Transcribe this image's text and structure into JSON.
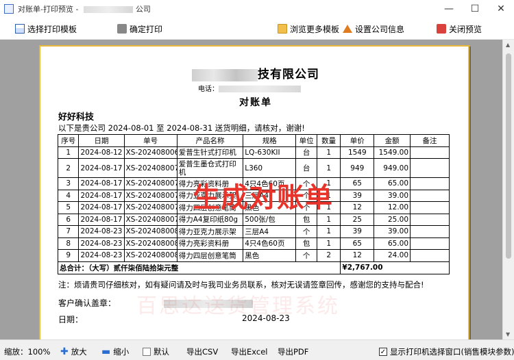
{
  "window": {
    "title_prefix": "对账单-打印预览 - ",
    "title_suffix": "公司",
    "buttons": {
      "minimize": "—",
      "maximize": "☐",
      "close": "✕"
    }
  },
  "toolbar": {
    "select_template": "选择打印模板",
    "confirm_print": "确定打印",
    "browse_templates": "浏览更多模板",
    "company_settings": "设置公司信息",
    "close_preview": "关闭预览"
  },
  "document": {
    "company_suffix": "技有限公司",
    "phone_label": "电话：",
    "title": "对账单",
    "customer": "好好科技",
    "intro": "以下是贵公司 2024-08-01 至 2024-08-31 送货明细，请核对，谢谢!",
    "headers": [
      "序号",
      "日期",
      "单号",
      "产品名称",
      "规格",
      "单位",
      "数量",
      "单价",
      "金额",
      "备注"
    ],
    "rows": [
      [
        "1",
        "2024-08-12",
        "XS-202408006",
        "爱普生针式打印机",
        "LQ-630KII",
        "台",
        "1",
        "1549",
        "1549.00",
        ""
      ],
      [
        "2",
        "2024-08-17",
        "XS-202408007",
        "爱普生墨仓式打印机",
        "L360",
        "台",
        "1",
        "949",
        "949.00",
        ""
      ],
      [
        "3",
        "2024-08-17",
        "XS-202408007",
        "得力亮彩资料册",
        "4只4色60页",
        "个",
        "1",
        "65",
        "65.00",
        ""
      ],
      [
        "4",
        "2024-08-17",
        "XS-202408007",
        "得力亚克力展示架",
        "三层A4",
        "个",
        "1",
        "39",
        "39.00",
        ""
      ],
      [
        "5",
        "2024-08-17",
        "XS-202408007",
        "得力四层创意笔筒",
        "黑色",
        "个",
        "1",
        "12",
        "12.00",
        ""
      ],
      [
        "6",
        "2024-08-17",
        "XS-202408007",
        "得力A4复印纸80g",
        "500张/包",
        "包",
        "1",
        "25",
        "25.00",
        ""
      ],
      [
        "7",
        "2024-08-23",
        "XS-202408008",
        "得力亚克力展示架",
        "三层A4",
        "个",
        "1",
        "39",
        "39.00",
        ""
      ],
      [
        "8",
        "2024-08-23",
        "XS-202408008",
        "得力亮彩资料册",
        "4只4色60页",
        "包",
        "1",
        "65",
        "65.00",
        ""
      ],
      [
        "9",
        "2024-08-23",
        "XS-202408008",
        "得力四层创意笔筒",
        "黑色",
        "个",
        "2",
        "12",
        "24.00",
        ""
      ]
    ],
    "total_label": "总合计：（大写）贰仟柒佰陆拾柒元整",
    "total_amount": "¥2,767.00",
    "note": "注：烦请贵司仔细核对，如有疑问请及时与我司业务员联系，核对无误请签章回传，感谢您的支持与配合!",
    "confirm_label": "客户确认盖章：",
    "date_label": "日期：",
    "date_value": "2024-08-23",
    "overlay_text": "生成对账单",
    "watermark_text": "百思达送货管理系统"
  },
  "status": {
    "zoom": "缩放：100%",
    "zoom_in": "放大",
    "zoom_out": "缩小",
    "default": "默认",
    "export_csv": "导出CSV",
    "export_excel": "导出Excel",
    "export_pdf": "导出PDF",
    "show_printer_dialog": "显示打印机选择窗口(销售模块参数)"
  },
  "colors": {
    "accent_red": "#e8332a",
    "paper_border": "#e8b93a",
    "viewer_bg": "#a0a0a0"
  }
}
